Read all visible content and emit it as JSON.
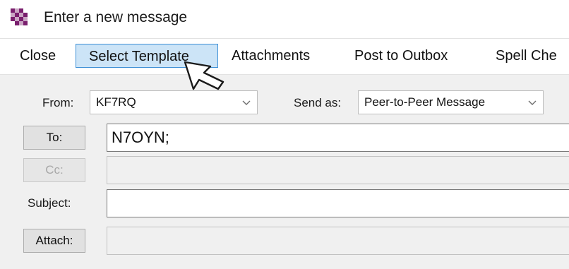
{
  "window": {
    "title": "Enter a new message",
    "icon": "checkered-app-icon"
  },
  "menu": {
    "items": [
      {
        "label": "Close"
      },
      {
        "label": "Select Template",
        "state": "hovered"
      },
      {
        "label": "Attachments"
      },
      {
        "label": "Post to Outbox"
      },
      {
        "label": "Spell Che"
      }
    ]
  },
  "form": {
    "from": {
      "label": "From:",
      "value": "KF7RQ"
    },
    "send_as": {
      "label": "Send as:",
      "value": "Peer-to-Peer Message"
    },
    "to": {
      "button_label": "To:",
      "value": "N7OYN;"
    },
    "cc": {
      "button_label": "Cc:",
      "value": "",
      "enabled": false
    },
    "subject": {
      "label": "Subject:",
      "value": ""
    },
    "attach": {
      "button_label": "Attach:",
      "value": "",
      "enabled": false
    }
  },
  "colors": {
    "hover_fill": "#cce4f7",
    "hover_border": "#3d8fd6",
    "form_background": "#f0f0f0",
    "icon_purple": "#7a1f6e"
  },
  "cursor": {
    "icon": "pointer-arrow-icon"
  }
}
